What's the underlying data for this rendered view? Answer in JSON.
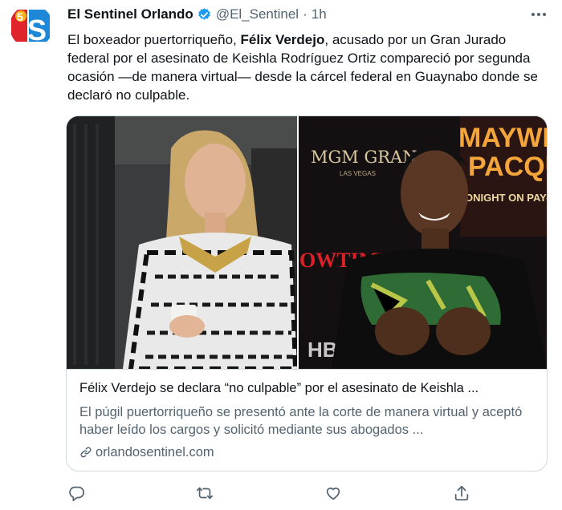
{
  "tweet": {
    "author_name": "El Sentinel Orlando",
    "handle": "@El_Sentinel",
    "separator": "·",
    "time": "1h",
    "text_before": "El boxeador puertorriqueño, ",
    "text_bold": "Félix Verdejo",
    "text_after": ", acusado por un Gran Jurado federal por el asesinato de Keishla Rodríguez Ortiz compareció por segunda ocasión —de manera virtual— desde la cárcel federal en Guaynabo donde se declaró no culpable."
  },
  "avatar": {
    "logo_text": "S",
    "badge_number": "5"
  },
  "card": {
    "title": "Félix Verdejo se declara “no culpable” por el asesinato de Keishla ...",
    "description": "El púgil puertorriqueño se presentó ante la corte de manera virtual y aceptó haber leído los cargos y solicitó mediante sus abogados ...",
    "domain": "orlandosentinel.com",
    "image_texts": {
      "mgm": "MGM GRAND",
      "mgm_sub": "LAS VEGAS",
      "mayweather": "MAYWEA",
      "pacquiao": "PACQUI",
      "ppv": "ONIGHT ON PAY-PE",
      "showtime": "OWTIME",
      "hbo": "HB"
    }
  },
  "icons": {
    "verified": "verified-badge-icon",
    "more": "more-icon",
    "reply": "reply-icon",
    "retweet": "retweet-icon",
    "like": "like-icon",
    "share": "share-icon",
    "link": "link-icon"
  },
  "colors": {
    "verified": "#1d9bf0",
    "secondary_text": "#536471",
    "border": "#cfd9de",
    "brand_red": "#e0242b",
    "brand_blue": "#1e88d8"
  }
}
